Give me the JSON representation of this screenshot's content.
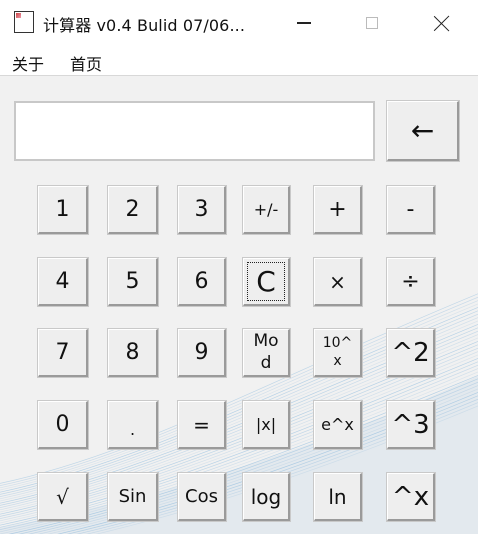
{
  "window": {
    "title": "计算器  v0.4  Bulid 07/06...",
    "icon": "calculator-app-icon"
  },
  "menu": {
    "items": [
      "关于",
      "首页"
    ]
  },
  "display": {
    "value": ""
  },
  "buttons": {
    "backspace": "←",
    "rows": [
      [
        "1",
        "2",
        "3",
        "+/-",
        "+",
        "-"
      ],
      [
        "4",
        "5",
        "6",
        "C",
        "×",
        "÷"
      ],
      [
        "7",
        "8",
        "9",
        "Mo\nd",
        "10^\nx",
        "^2"
      ],
      [
        "0",
        ".",
        "=",
        "|x|",
        "e^x",
        "^3"
      ],
      [
        "√",
        "Sin",
        "Cos",
        "log",
        "ln",
        "^x"
      ]
    ]
  },
  "colors": {
    "client_background": "#f1f1f1",
    "button_face": "#eeeeee",
    "wave_accent": "#3a8fd0"
  }
}
